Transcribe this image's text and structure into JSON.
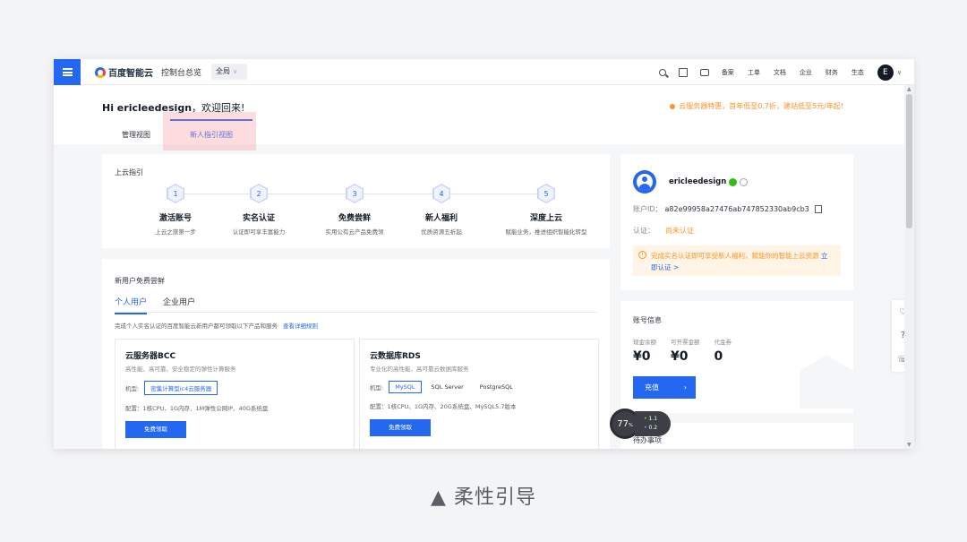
{
  "topnav": {
    "brand": "百度智能云",
    "console": "控制台总览",
    "region": "全局",
    "items": [
      "备案",
      "工单",
      "文档",
      "企业",
      "财务",
      "生态"
    ],
    "avatar_initial": "E"
  },
  "header": {
    "greeting_name": "Hi ericleedesign",
    "greeting_rest": "，欢迎回来!",
    "promo": "云服务器特惠，首年低至0.7折，建站低至5元/年起!",
    "tabs": [
      "管理视图",
      "新人指引视图"
    ]
  },
  "guide": {
    "title": "上云指引",
    "steps": [
      {
        "num": "1",
        "title": "激活账号",
        "desc": "上云之旅第一步"
      },
      {
        "num": "2",
        "title": "实名认证",
        "desc": "认证即可享丰富能力"
      },
      {
        "num": "3",
        "title": "免费尝鲜",
        "desc": "实用公有云产品免费领"
      },
      {
        "num": "4",
        "title": "新人福利",
        "desc": "优质资源五折起"
      },
      {
        "num": "5",
        "title": "深度上云",
        "desc": "赋能业务，推进组织智能化转型"
      }
    ]
  },
  "trial": {
    "title": "新用户免费尝鲜",
    "tabs": [
      "个人用户",
      "企业用户"
    ],
    "note": "完成个人实名认证的百度智能云新用户都可领取以下产品和服务",
    "note_link": "查看详细规则",
    "products": [
      {
        "name": "云服务器BCC",
        "desc": "高性能、高可靠、安全稳定的弹性计算服务",
        "row_label": "机型:",
        "options": [
          "密集计算型ic4云服务器"
        ],
        "spec": "配置：1核CPU、1G内存、1M弹性公网IP、40G系统盘",
        "button": "免费领取"
      },
      {
        "name": "云数据库RDS",
        "desc": "专业化的高性能、高可靠云数据库服务",
        "row_label": "机型:",
        "options": [
          "MySQL",
          "SQL Server",
          "PostgreSQL"
        ],
        "spec": "配置：1核CPU、1G内存、20G系统盘、MySQL5.7版本",
        "button": "免费领取"
      }
    ]
  },
  "user": {
    "name": "ericleedesign",
    "id_label": "账户ID：",
    "id_value": "a82e99958a27476ab747852330ab9cb3",
    "cert_label": "认证：",
    "cert_value": "尚未认证",
    "warn_text": "完成实名认证即可享受新人福利，赋能你的智能上云资源",
    "warn_link": "立即认证 >"
  },
  "account": {
    "title": "账号信息",
    "cols": [
      {
        "label": "现金余额",
        "value": "¥0"
      },
      {
        "label": "可开票金额",
        "value": "¥0"
      },
      {
        "label": "代金券",
        "value": "0"
      }
    ],
    "button": "充值"
  },
  "todo": {
    "title": "待办事项"
  },
  "speed": {
    "percent": "77",
    "percent_unit": "%",
    "up": "1.1",
    "down": "0.2"
  },
  "caption": "▲ 柔性引导",
  "colors": {
    "accent": "#2468f2",
    "warning": "#ff9326",
    "highlight": "#f68c96"
  }
}
